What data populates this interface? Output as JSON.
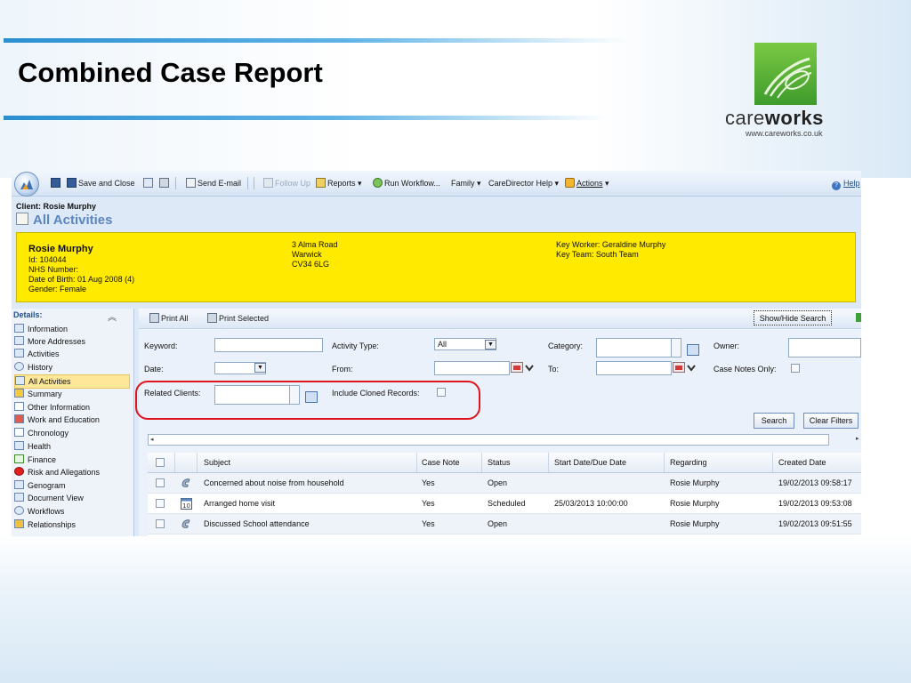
{
  "slide": {
    "title": "Combined Case Report",
    "logo_word_a": "care",
    "logo_word_b": "works",
    "logo_url": "www.careworks.co.uk"
  },
  "toolbar": {
    "save_and_close": "Save and Close",
    "send_email": "Send E-mail",
    "follow_up": "Follow Up",
    "reports": "Reports",
    "run_workflow": "Run Workflow...",
    "family": "Family",
    "caredirector_help": "CareDirector Help",
    "actions": "Actions",
    "help": "Help"
  },
  "header": {
    "client_line": "Client: Rosie Murphy",
    "page_title": "All Activities"
  },
  "client": {
    "name": "Rosie Murphy",
    "id": "Id: 104044",
    "nhs": "NHS Number:",
    "dob": "Date of Birth: 01 Aug 2008 (4)",
    "gender": "Gender: Female",
    "addr1": "3 Alma Road",
    "addr2": "Warwick",
    "addr3": "CV34 6LG",
    "key_worker": "Key Worker: Geraldine Murphy",
    "key_team": "Key Team: South Team"
  },
  "sidebar": {
    "heading": "Details:",
    "items": [
      {
        "label": "Information"
      },
      {
        "label": "More Addresses"
      },
      {
        "label": "Activities"
      },
      {
        "label": "History"
      },
      {
        "label": "All Activities"
      },
      {
        "label": "Summary"
      },
      {
        "label": "Other Information"
      },
      {
        "label": "Work and Education"
      },
      {
        "label": "Chronology"
      },
      {
        "label": "Health"
      },
      {
        "label": "Finance"
      },
      {
        "label": "Risk and Allegations"
      },
      {
        "label": "Genogram"
      },
      {
        "label": "Document View"
      },
      {
        "label": "Workflows"
      },
      {
        "label": "Relationships"
      }
    ]
  },
  "search": {
    "print_all": "Print All",
    "print_selected": "Print Selected",
    "show_hide": "Show/Hide Search",
    "keyword": "Keyword:",
    "activity_type": "Activity Type:",
    "activity_type_value": "All",
    "category": "Category:",
    "owner": "Owner:",
    "date": "Date:",
    "from": "From:",
    "to": "To:",
    "case_notes_only": "Case Notes Only:",
    "related_clients": "Related Clients:",
    "include_cloned": "Include Cloned Records:",
    "search_btn": "Search",
    "clear_btn": "Clear Filters"
  },
  "grid": {
    "headers": [
      "Subject",
      "Case Note",
      "Status",
      "Start Date/Due Date",
      "Regarding",
      "Created Date"
    ],
    "rows": [
      {
        "subject": "Concerned about noise from household",
        "case_note": "Yes",
        "status": "Open",
        "start": "",
        "regarding": "Rosie Murphy",
        "created": "19/02/2013 09:58:17"
      },
      {
        "subject": "Arranged home visit",
        "case_note": "Yes",
        "status": "Scheduled",
        "start": "25/03/2013 10:00:00",
        "regarding": "Rosie Murphy",
        "created": "19/02/2013 09:53:08"
      },
      {
        "subject": "Discussed School attendance",
        "case_note": "Yes",
        "status": "Open",
        "start": "",
        "regarding": "Rosie Murphy",
        "created": "19/02/2013 09:51:55"
      }
    ]
  },
  "colors": {
    "swoosh": "#2a8fd0",
    "banner": "#ffea00",
    "highlight": "#e0141c",
    "logo_green": "#4caf34"
  }
}
